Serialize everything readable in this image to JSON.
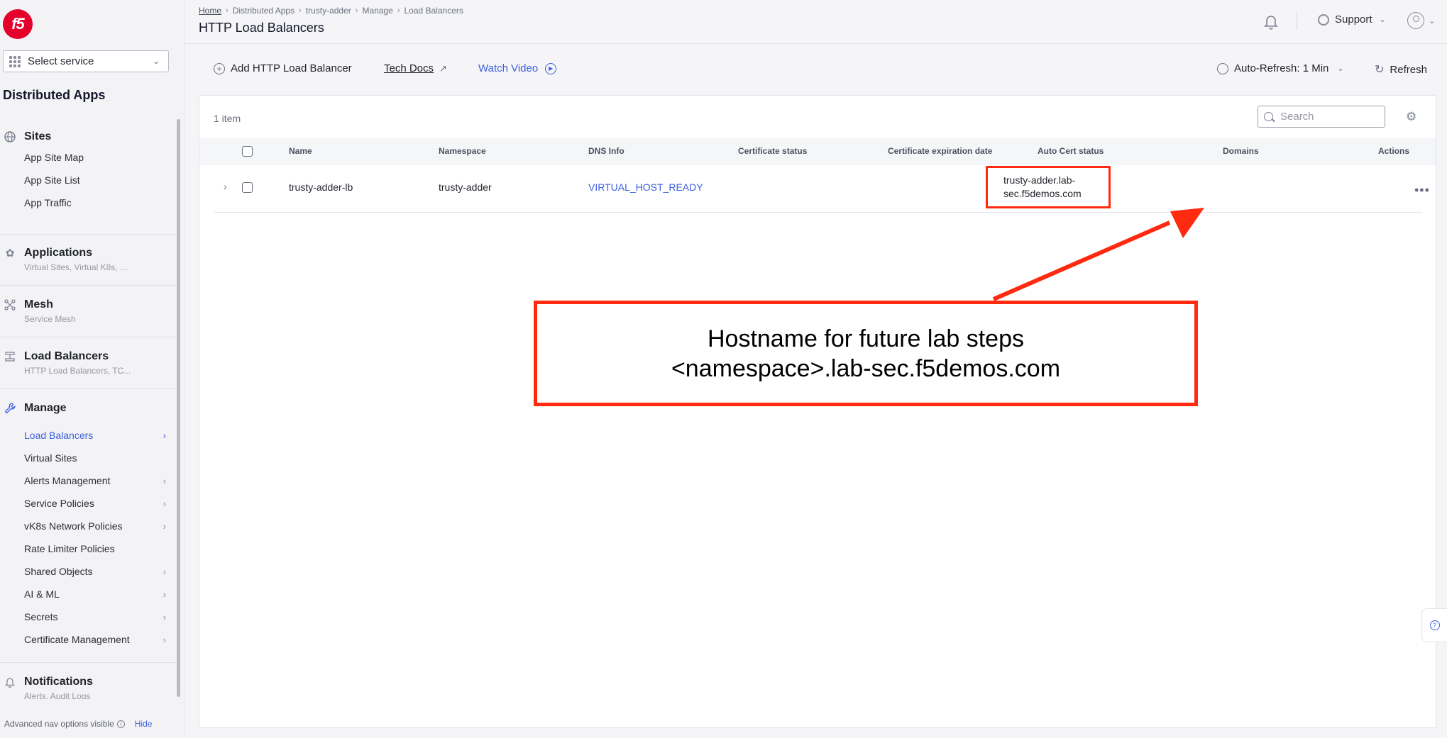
{
  "sidebar": {
    "logo_text": "f5",
    "service_select": "Select service",
    "app_title": "Distributed Apps",
    "sections": {
      "sites": {
        "title": "Sites",
        "items": [
          "App Site Map",
          "App Site List",
          "App Traffic"
        ]
      },
      "applications": {
        "title": "Applications",
        "subtitle": "Virtual Sites, Virtual K8s, ..."
      },
      "mesh": {
        "title": "Mesh",
        "subtitle": "Service Mesh"
      },
      "load_balancers": {
        "title": "Load Balancers",
        "subtitle": "HTTP Load Balancers, TC..."
      },
      "manage": {
        "title": "Manage",
        "items": [
          "Load Balancers",
          "Virtual Sites",
          "Alerts Management",
          "Service Policies",
          "vK8s Network Policies",
          "Rate Limiter Policies",
          "Shared Objects",
          "AI & ML",
          "Secrets",
          "Certificate Management"
        ]
      },
      "notifications": {
        "title": "Notifications",
        "subtitle": "Alerts, Audit Logs"
      }
    },
    "advanced_note": "Advanced nav options visible",
    "hide_label": "Hide"
  },
  "header": {
    "breadcrumb": [
      "Home",
      "Distributed Apps",
      "trusty-adder",
      "Manage",
      "Load Balancers"
    ],
    "title": "HTTP Load Balancers",
    "support_label": "Support"
  },
  "toolbar": {
    "add_label": "Add HTTP Load Balancer",
    "tech_docs": "Tech Docs",
    "watch_video": "Watch Video",
    "auto_refresh": "Auto-Refresh: 1 Min",
    "refresh": "Refresh"
  },
  "table": {
    "count": "1 item",
    "search_placeholder": "Search",
    "columns": [
      "Name",
      "Namespace",
      "DNS Info",
      "Certificate status",
      "Certificate expiration date",
      "Auto Cert status",
      "Domains",
      "Actions"
    ],
    "rows": [
      {
        "name": "trusty-adder-lb",
        "namespace": "trusty-adder",
        "dns_info": "VIRTUAL_HOST_READY",
        "certificate_status": "",
        "certificate_expiration": "",
        "auto_cert_status": "",
        "domains_line1": "trusty-adder.lab-",
        "domains_line2": "sec.f5demos.com"
      }
    ]
  },
  "annotation": {
    "line1": "Hostname for future lab steps",
    "line2": "<namespace>.lab-sec.f5demos.com",
    "color": "#ff2a10"
  },
  "colors": {
    "accent": "#3b5fe0",
    "brand": "#e4002b",
    "annotation": "#ff2a10"
  }
}
